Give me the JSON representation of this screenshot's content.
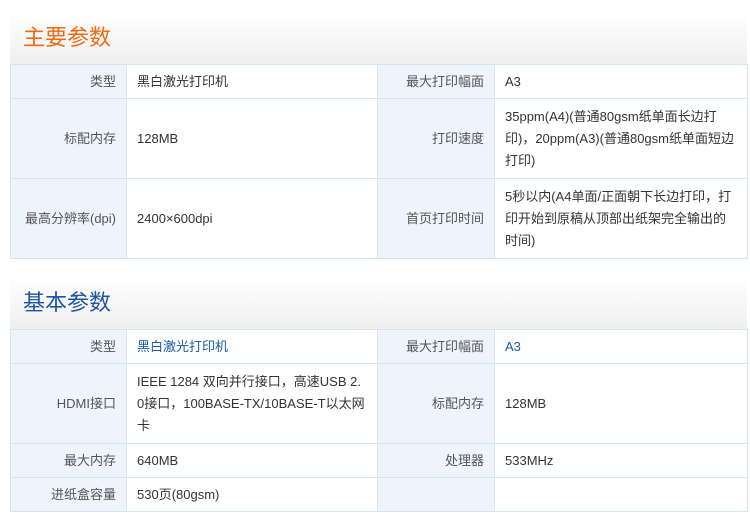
{
  "main_params": {
    "title": "主要参数",
    "rows": [
      {
        "l1": "类型",
        "v1": "黑白激光打印机",
        "l2": "最大打印幅面",
        "v2": "A3"
      },
      {
        "l1": "标配内存",
        "v1": "128MB",
        "l2": "打印速度",
        "v2": "35ppm(A4)(普通80gsm纸单面长边打印)，20ppm(A3)(普通80gsm纸单面短边打印)"
      },
      {
        "l1": "最高分辨率(dpi)",
        "v1": "2400×600dpi",
        "l2": "首页打印时间",
        "v2": "5秒以内(A4单面/正面朝下长边打印，打印开始到原稿从顶部出纸架完全输出的时间)"
      }
    ]
  },
  "basic_params": {
    "title": "基本参数",
    "rows": [
      {
        "l1": "类型",
        "v1": "黑白激光打印机",
        "l2": "最大打印幅面",
        "v2": "A3"
      },
      {
        "l1": "HDMI接口",
        "v1": "IEEE 1284 双向并行接口，高速USB 2.0接口，100BASE-TX/10BASE-T以太网卡",
        "l2": "标配内存",
        "v2": "128MB"
      },
      {
        "l1": "最大内存",
        "v1": "640MB",
        "l2": "处理器",
        "v2": "533MHz"
      },
      {
        "l1": "进纸盒容量",
        "v1": "530页(80gsm)",
        "l2": "",
        "v2": ""
      }
    ]
  }
}
